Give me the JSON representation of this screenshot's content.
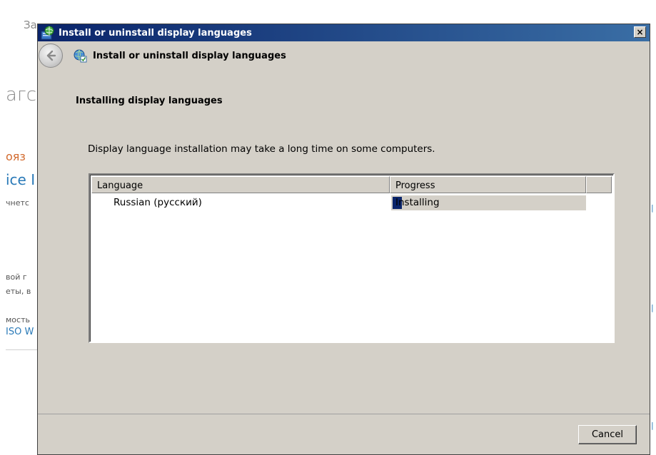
{
  "background": {
    "fragments": [
      "За",
      "агс",
      "ояз",
      "ice I",
      "чнетс",
      "вой г",
      "еты, в",
      "мость",
      "ISO W"
    ]
  },
  "dialog": {
    "window_title": "Install or uninstall display languages",
    "nav_title": "Install or uninstall display languages",
    "heading": "Installing display languages",
    "description": "Display language installation may take a long time on some computers.",
    "columns": [
      "Language",
      "Progress"
    ],
    "rows": [
      {
        "language": "Russian (русский)",
        "progress_label": "Installing",
        "progress": 0.05
      }
    ],
    "cancel_label": "Cancel",
    "close_glyph": "×"
  },
  "icons": {
    "title": "language-installer-icon",
    "back": "back-arrow-icon",
    "nav": "language-globe-icon"
  },
  "colors": {
    "titlebar_start": "#0a246a",
    "titlebar_end": "#3a6ea5",
    "face": "#d4d0c8",
    "progress_fill": "#0a246a",
    "link_blue": "#2a7ab8",
    "accent_orange": "#d26a2e"
  }
}
